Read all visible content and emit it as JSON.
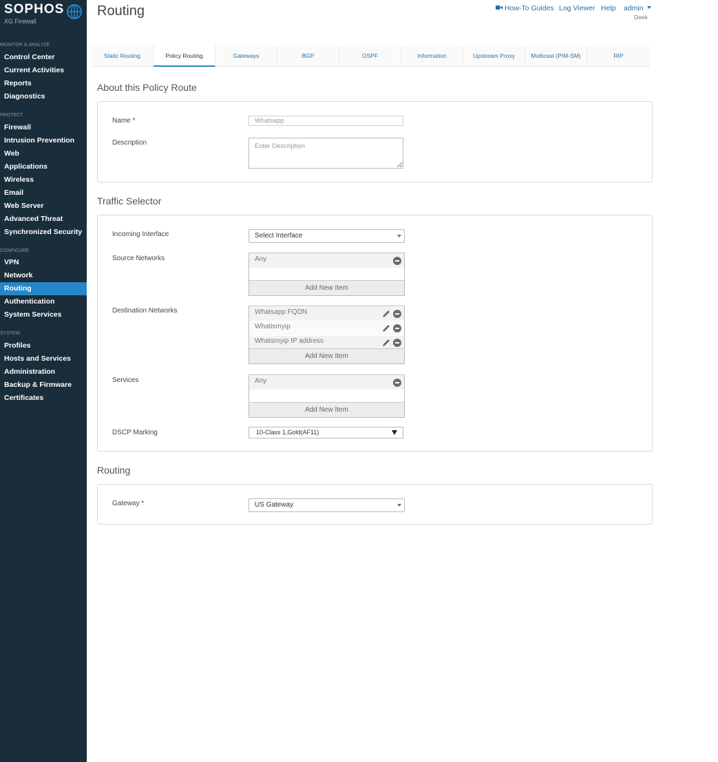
{
  "sidebar": {
    "logo": "SOPHOS",
    "product": "XG Firewall",
    "sections": {
      "monitor": "MONITOR & ANALYZE",
      "protect": "PROTECT",
      "configure": "CONFIGURE",
      "system": "SYSTEM"
    },
    "items": {
      "control_center": "Control Center",
      "current_activities": "Current Activities",
      "reports": "Reports",
      "diagnostics": "Diagnostics",
      "firewall": "Firewall",
      "intrusion_prevention": "Intrusion Prevention",
      "web": "Web",
      "applications": "Applications",
      "wireless": "Wireless",
      "email": "Email",
      "web_server": "Web Server",
      "advanced_threat": "Advanced Threat",
      "synchronized_security": "Synchronized Security",
      "vpn": "VPN",
      "network": "Network",
      "routing": "Routing",
      "authentication": "Authentication",
      "system_services": "System Services",
      "profiles": "Profiles",
      "hosts_and_services": "Hosts and Services",
      "administration": "Administration",
      "backup_firmware": "Backup & Firmware",
      "certificates": "Certificates"
    }
  },
  "header": {
    "title": "Routing",
    "how_to": "How-To Guides",
    "log_viewer": "Log Viewer",
    "help": "Help",
    "user": "admin",
    "user_sub": "Deek"
  },
  "tabs": {
    "static": "Static Routing",
    "policy": "Policy Routing",
    "gateways": "Gateways",
    "bgp": "BGP",
    "ospf": "OSPF",
    "information": "Information",
    "upstream": "Upstream Proxy",
    "multicast": "Multicast (PIM-SM)",
    "rip": "RIP"
  },
  "about": {
    "title": "About this Policy Route",
    "name_label": "Name *",
    "name_value": "Whatsapp",
    "desc_label": "Description",
    "desc_placeholder": "Enter Description"
  },
  "traffic": {
    "title": "Traffic Selector",
    "incoming_label": "Incoming Interface",
    "incoming_value": "Select Interface",
    "source_label": "Source Networks",
    "source_items": [
      "Any"
    ],
    "dest_label": "Destination Networks",
    "dest_items": [
      "Whatsapp FQDN",
      "Whatismyip",
      "Whatsmyip IP address"
    ],
    "services_label": "Services",
    "services_items": [
      "Any"
    ],
    "add_new": "Add New Item",
    "dscp_label": "DSCP Marking",
    "dscp_value": "10-Class 1,Gold(AF11)"
  },
  "routing": {
    "title": "Routing",
    "gateway_label": "Gateway *",
    "gateway_value": "US Gateway"
  },
  "colors": {
    "sidebar_bg": "#1a2d3a",
    "accent": "#2587c9",
    "link": "#2470a8"
  },
  "icons": [
    "globe-icon",
    "video-icon",
    "caret-down-icon",
    "edit-icon",
    "remove-icon"
  ]
}
